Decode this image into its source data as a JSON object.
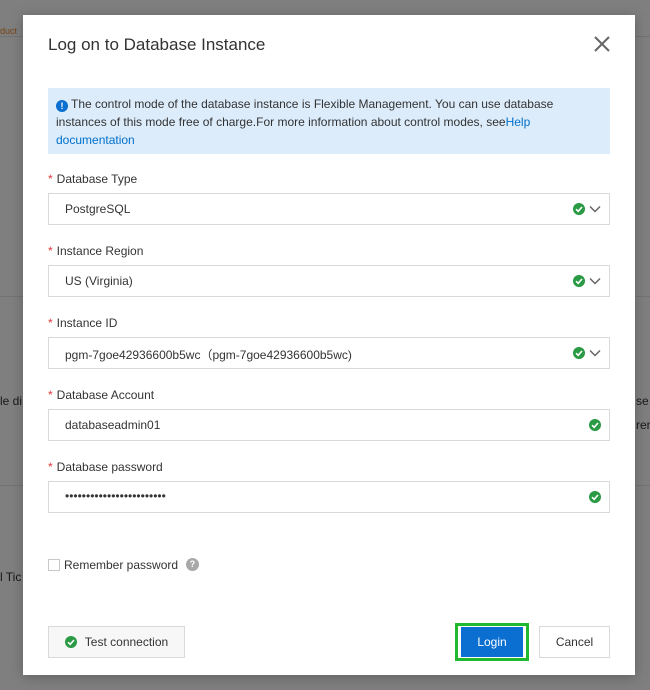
{
  "background": {
    "tag_text": "duct",
    "snippet_left_1": "le di",
    "snippet_left_2": "l Tic",
    "snippet_right_1": "se",
    "snippet_right_2": "ren"
  },
  "dialog": {
    "title": "Log on to Database Instance",
    "notice": {
      "text": "The control mode of the database instance is Flexible Management. You can use database instances of this mode free of charge.For more information about control modes, see",
      "link_text": "Help documentation"
    },
    "fields": {
      "database_type": {
        "label": "Database Type",
        "value": "PostgreSQL"
      },
      "instance_region": {
        "label": "Instance Region",
        "value": "US (Virginia)"
      },
      "instance_id": {
        "label": "Instance ID",
        "value": "pgm-7goe42936600b5wc（pgm-7goe42936600b5wc)"
      },
      "database_account": {
        "label": "Database Account",
        "value": "databaseadmin01"
      },
      "database_password": {
        "label": "Database password",
        "value": "••••••••••••••••••••••••"
      }
    },
    "required_marker": "*",
    "remember_password_label": "Remember password",
    "help_icon_glyph": "?",
    "buttons": {
      "test_connection": "Test connection",
      "login": "Login",
      "cancel": "Cancel"
    }
  },
  "colors": {
    "primary": "#0a6fd0",
    "success": "#2a9a44",
    "highlight": "#1fb82e",
    "required": "#e0393e"
  }
}
